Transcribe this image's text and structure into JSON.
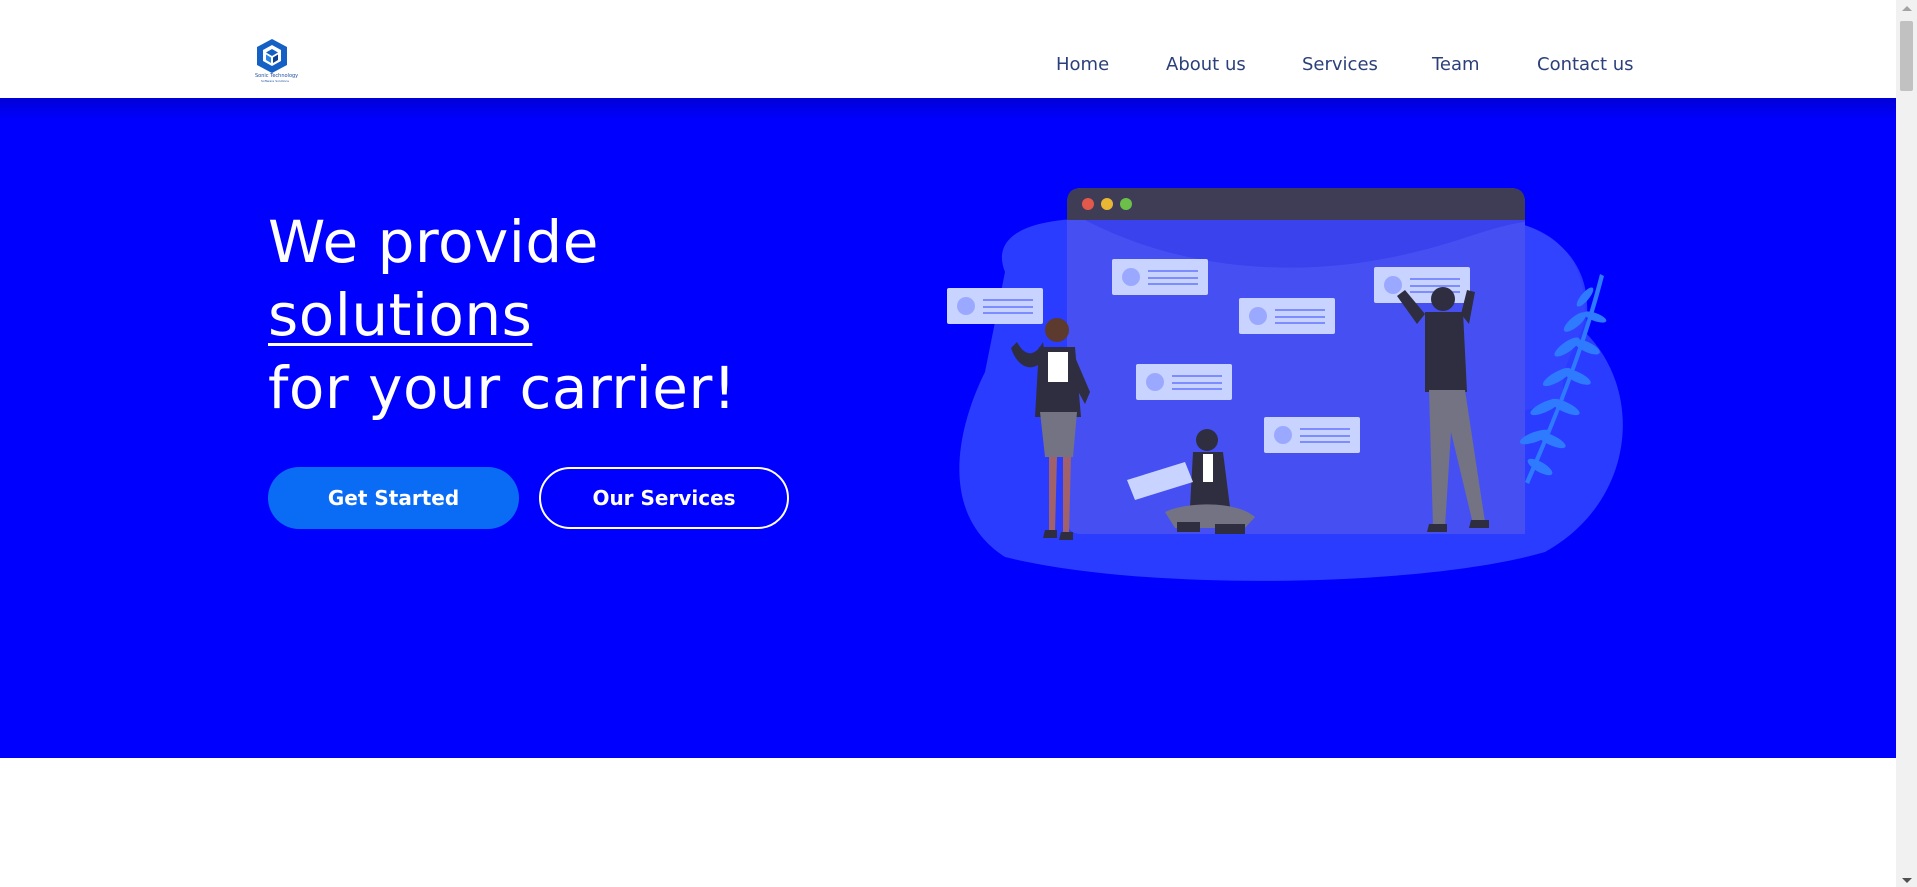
{
  "header": {
    "logo_text_line1": "Sonic Technology",
    "logo_text_line2": "Software Solutions",
    "nav": [
      {
        "label": "Home"
      },
      {
        "label": "About us"
      },
      {
        "label": "Services"
      },
      {
        "label": "Team"
      },
      {
        "label": "Contact us"
      }
    ]
  },
  "hero": {
    "headline_line1": "We provide",
    "headline_line2": "solutions",
    "headline_line3": "for your carrier!",
    "primary_button": "Get Started",
    "secondary_button": "Our Services",
    "illustration": "team-collaboration-illustration"
  },
  "colors": {
    "hero_background": "#0000ff",
    "primary_button": "#0a6cf5",
    "nav_text": "#2b3f7a"
  }
}
